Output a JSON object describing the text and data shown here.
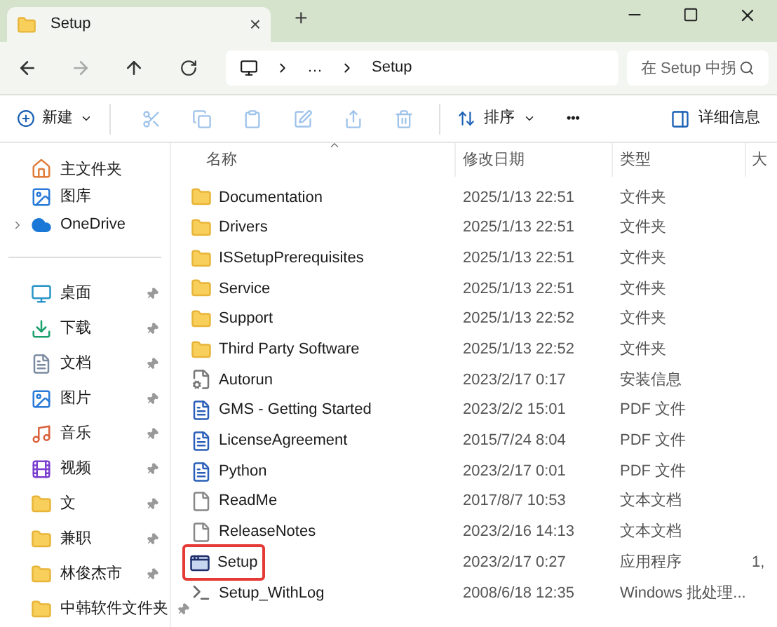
{
  "tab": {
    "title": "Setup",
    "close": "×",
    "new": "+"
  },
  "address": {
    "crumbs": [
      "…",
      "Setup"
    ]
  },
  "search": {
    "placeholder": "在 Setup 中拐"
  },
  "toolbar": {
    "new": "新建",
    "sort": "排序",
    "more": "•••",
    "details": "详细信息"
  },
  "sidebar": {
    "top": [
      {
        "label": "主文件夹",
        "kind": "home",
        "expandable": false
      },
      {
        "label": "图库",
        "kind": "gallery",
        "expandable": false
      },
      {
        "label": "OneDrive",
        "kind": "cloud",
        "expandable": true
      }
    ],
    "pinned": [
      {
        "label": "桌面",
        "kind": "desktop"
      },
      {
        "label": "下载",
        "kind": "download"
      },
      {
        "label": "文档",
        "kind": "document"
      },
      {
        "label": "图片",
        "kind": "picture"
      },
      {
        "label": "音乐",
        "kind": "music"
      },
      {
        "label": "视频",
        "kind": "video"
      },
      {
        "label": "文",
        "kind": "folder"
      },
      {
        "label": "兼职",
        "kind": "folder"
      },
      {
        "label": "林俊杰市",
        "kind": "folder"
      },
      {
        "label": "中韩软件文件夹",
        "kind": "folder"
      }
    ]
  },
  "table": {
    "columns": [
      "名称",
      "修改日期",
      "类型",
      "大"
    ],
    "rows": [
      {
        "name": "Documentation",
        "date": "2025/1/13 22:51",
        "type": "文件夹",
        "kind": "folder",
        "highlighted": false
      },
      {
        "name": "Drivers",
        "date": "2025/1/13 22:51",
        "type": "文件夹",
        "kind": "folder",
        "highlighted": false
      },
      {
        "name": "ISSetupPrerequisites",
        "date": "2025/1/13 22:51",
        "type": "文件夹",
        "kind": "folder",
        "highlighted": false
      },
      {
        "name": "Service",
        "date": "2025/1/13 22:51",
        "type": "文件夹",
        "kind": "folder",
        "highlighted": false
      },
      {
        "name": "Support",
        "date": "2025/1/13 22:52",
        "type": "文件夹",
        "kind": "folder",
        "highlighted": false
      },
      {
        "name": "Third Party Software",
        "date": "2025/1/13 22:52",
        "type": "文件夹",
        "kind": "folder",
        "highlighted": false
      },
      {
        "name": "Autorun",
        "date": "2023/2/17 0:17",
        "type": "安装信息",
        "kind": "config",
        "highlighted": false
      },
      {
        "name": "GMS - Getting Started",
        "date": "2023/2/2 15:01",
        "type": "PDF 文件",
        "kind": "pdf",
        "highlighted": false
      },
      {
        "name": "LicenseAgreement",
        "date": "2015/7/24 8:04",
        "type": "PDF 文件",
        "kind": "pdf",
        "highlighted": false
      },
      {
        "name": "Python",
        "date": "2023/2/17 0:01",
        "type": "PDF 文件",
        "kind": "pdf",
        "highlighted": false
      },
      {
        "name": "ReadMe",
        "date": "2017/8/7 10:53",
        "type": "文本文档",
        "kind": "text",
        "highlighted": false
      },
      {
        "name": "ReleaseNotes",
        "date": "2023/2/16 14:13",
        "type": "文本文档",
        "kind": "text",
        "highlighted": false
      },
      {
        "name": "Setup",
        "date": "2023/2/17 0:27",
        "type": "应用程序",
        "size": "1,",
        "kind": "app",
        "highlighted": true
      },
      {
        "name": "Setup_WithLog",
        "date": "2008/6/18 12:35",
        "type": "Windows 批处理...",
        "kind": "batch",
        "highlighted": false
      }
    ]
  }
}
